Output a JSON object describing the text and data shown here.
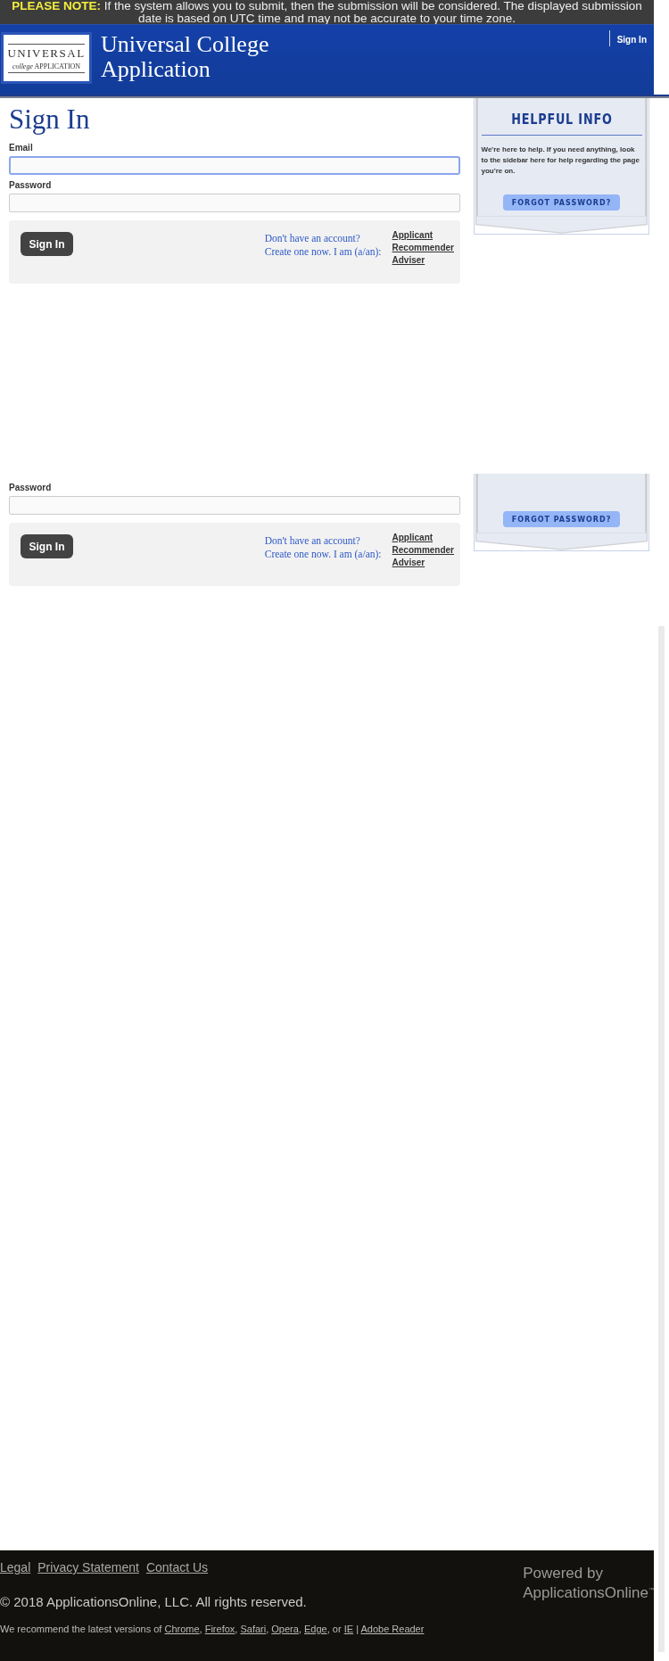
{
  "notice": {
    "label": "PLEASE NOTE:",
    "text": "If the system allows you to submit, then the submission will be considered. The displayed submission date is based on UTC time and may not be accurate to your time zone."
  },
  "header": {
    "logo": {
      "line_1": "UNIVERSAL",
      "line_2_italic": "college",
      "line_2": "APPLICATION"
    },
    "title": "Universal College Application",
    "nav": [
      {
        "label": "Sign In"
      }
    ]
  },
  "sign_in": {
    "title": "Sign In",
    "fields": [
      {
        "label": "Email",
        "focused": true
      },
      {
        "label": "Password",
        "focused": false
      }
    ],
    "button": "Sign In",
    "prompt": [
      "Don't have an account?",
      "Create one now. I am (a/an):"
    ],
    "roles": [
      "Applicant",
      "Recommender",
      "Adviser"
    ]
  },
  "help": {
    "title": "HELPFUL INFO",
    "text": "We're here to help. If you need anything, look to the sidebar here for help regarding the page you're on.",
    "button": "FORGOT PASSWORD?"
  },
  "repeat": {
    "fields": [
      {
        "label": "Password",
        "focused": false
      }
    ],
    "button": "Sign In",
    "prompt": [
      "Don't have an account?",
      "Create one now. I am (a/an):"
    ],
    "roles": [
      "Applicant",
      "Recommender",
      "Adviser"
    ],
    "help_button": "FORGOT PASSWORD?"
  },
  "footer": {
    "links": [
      "Legal",
      "Privacy Statement",
      "Contact Us"
    ],
    "powered_by": [
      "Powered by",
      "ApplicationsOnline"
    ],
    "trademark": "™",
    "copyright": "© 2018 ApplicationsOnline, LLC. All rights reserved.",
    "recommend": [
      {
        "kind": "text",
        "text": "We recommend the latest versions of "
      },
      {
        "kind": "link",
        "text": "Chrome"
      },
      {
        "kind": "text",
        "text": ", "
      },
      {
        "kind": "link",
        "text": "Firefox"
      },
      {
        "kind": "text",
        "text": ", "
      },
      {
        "kind": "link",
        "text": "Safari"
      },
      {
        "kind": "text",
        "text": ", "
      },
      {
        "kind": "link",
        "text": "Opera"
      },
      {
        "kind": "text",
        "text": ", "
      },
      {
        "kind": "link",
        "text": "Edge"
      },
      {
        "kind": "text",
        "text": ", or "
      },
      {
        "kind": "link",
        "text": "IE"
      },
      {
        "kind": "text",
        "text": " | "
      },
      {
        "kind": "link",
        "text": "Adobe Reader"
      }
    ]
  }
}
